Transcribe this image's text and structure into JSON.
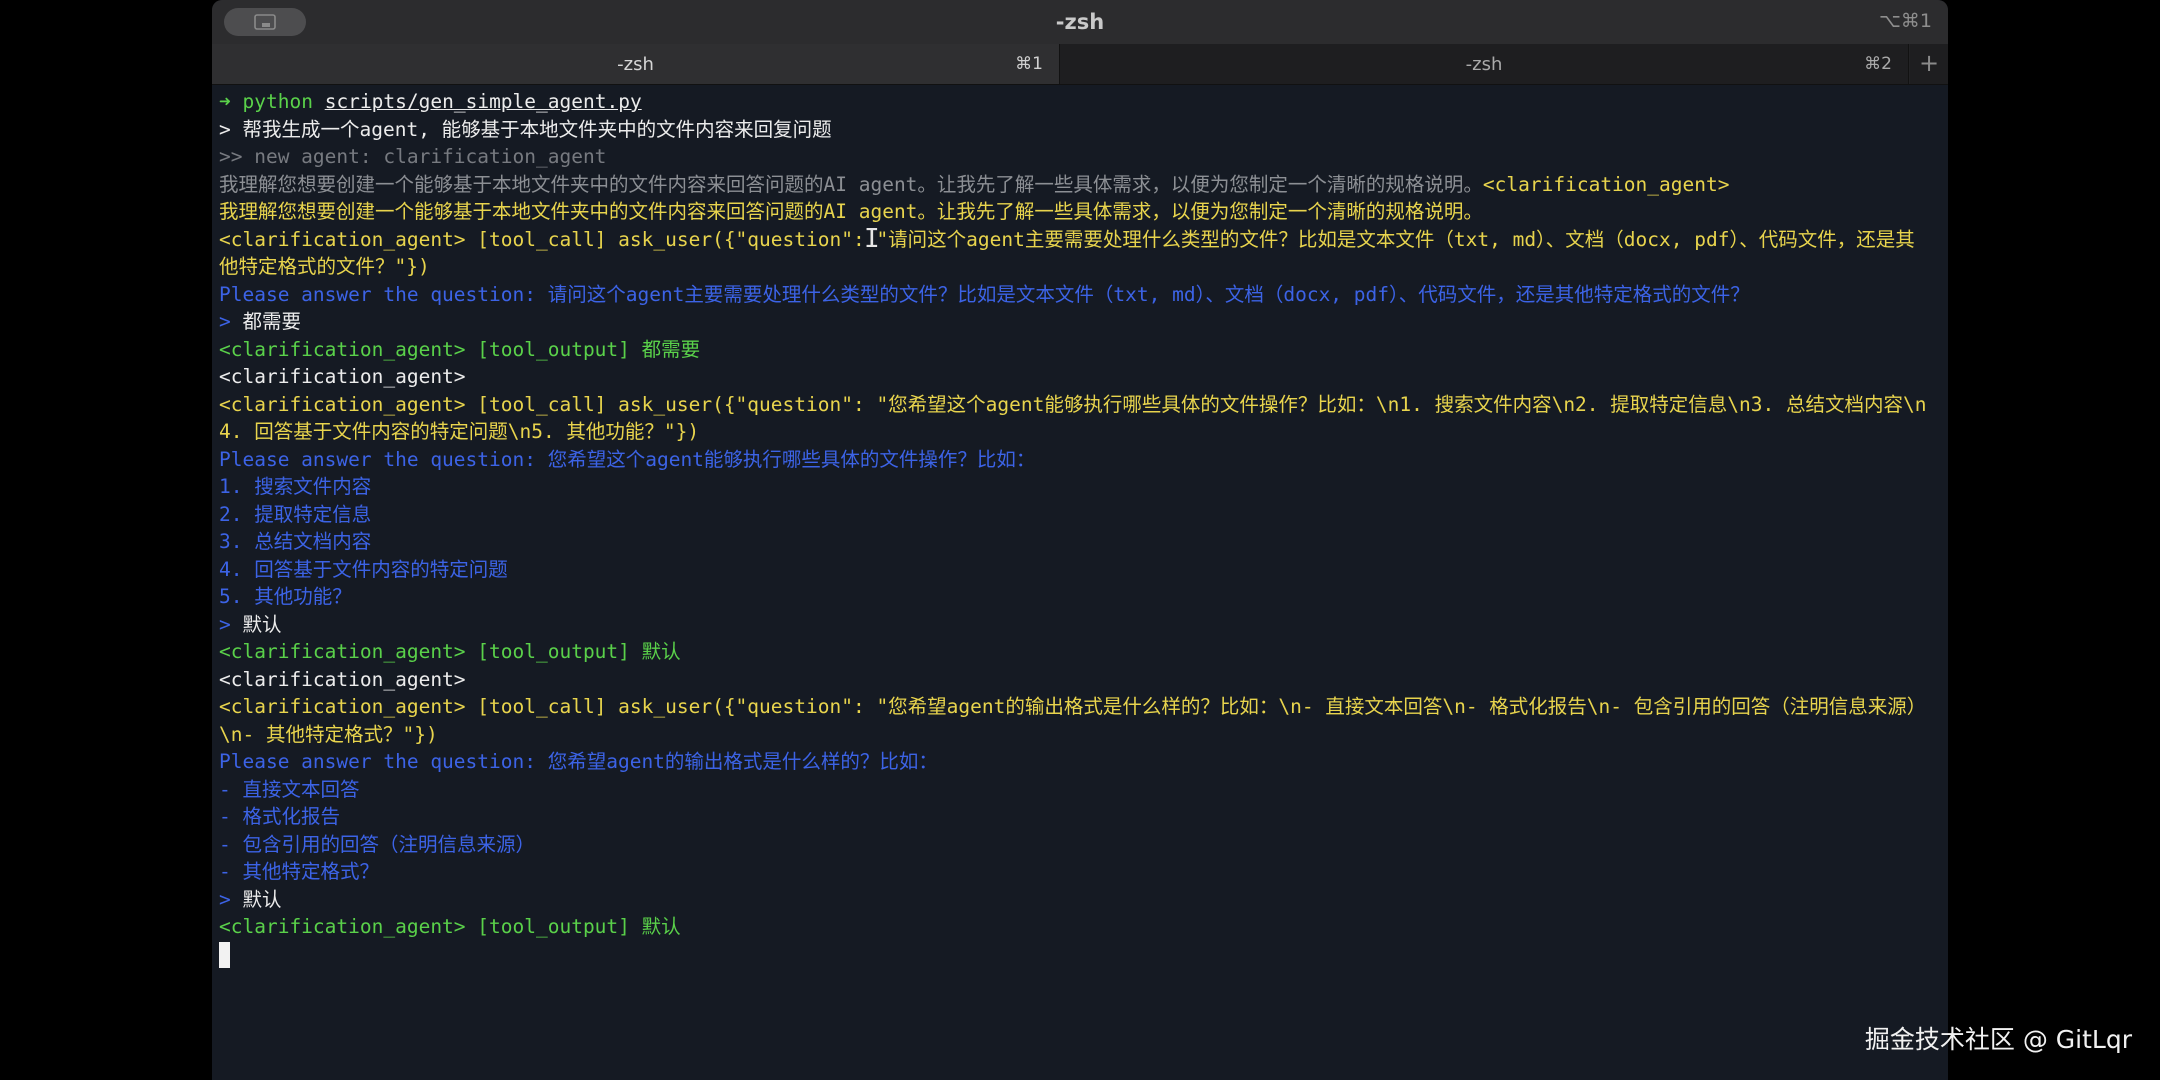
{
  "window": {
    "title": "-zsh",
    "shortcut": "⌥⌘1"
  },
  "tabs": [
    {
      "label": "-zsh",
      "key": "⌘1"
    },
    {
      "label": "-zsh",
      "key": "⌘2"
    }
  ],
  "new_tab_symbol": "+",
  "terminal": {
    "l1_arrow": "➜",
    "l1_cmd": "python",
    "l1_arg": "scripts/gen_simple_agent.py",
    "l2_prompt": ">",
    "l2_text": "帮我生成一个agent, 能够基于本地文件夹中的文件内容来回复问题",
    "l3": ">> new agent: clarification_agent",
    "l4_text": "我理解您想要创建一个能够基于本地文件夹中的文件内容来回答问题的AI agent。让我先了解一些具体需求，以便为您制定一个清晰的规格说明。",
    "l4_tag": "<clarification_agent>",
    "l5": "我理解您想要创建一个能够基于本地文件夹中的文件内容来回答问题的AI agent。让我先了解一些具体需求，以便为您制定一个清晰的规格说明。",
    "l6": "<clarification_agent> [tool_call] ask_user({\"question\": \"请问这个agent主要需要处理什么类型的文件？比如是文本文件（txt, md）、文档（docx, pdf）、代码文件，还是其他特定格式的文件？\"})",
    "l7": "Please answer the question: 请问这个agent主要需要处理什么类型的文件？比如是文本文件（txt, md）、文档（docx, pdf）、代码文件，还是其他特定格式的文件？",
    "l8_prompt": ">",
    "l8_text": "都需要",
    "l9": "<clarification_agent> [tool_output] 都需要",
    "l10": "<clarification_agent>",
    "l11": "<clarification_agent> [tool_call] ask_user({\"question\": \"您希望这个agent能够执行哪些具体的文件操作？比如：\\n1. 搜索文件内容\\n2. 提取特定信息\\n3. 总结文档内容\\n4. 回答基于文件内容的特定问题\\n5. 其他功能？\"})",
    "l12": "Please answer the question: 您希望这个agent能够执行哪些具体的文件操作？比如：",
    "l13": "1. 搜索文件内容",
    "l14": "2. 提取特定信息",
    "l15": "3. 总结文档内容",
    "l16": "4. 回答基于文件内容的特定问题",
    "l17": "5. 其他功能？",
    "l18_prompt": ">",
    "l18_text": "默认",
    "l19": "<clarification_agent> [tool_output] 默认",
    "l20": "<clarification_agent>",
    "l21": "<clarification_agent> [tool_call] ask_user({\"question\": \"您希望agent的输出格式是什么样的？比如：\\n- 直接文本回答\\n- 格式化报告\\n- 包含引用的回答（注明信息来源）\\n- 其他特定格式？\"})",
    "l22": "Please answer the question: 您希望agent的输出格式是什么样的？比如：",
    "l23": "- 直接文本回答",
    "l24": "- 格式化报告",
    "l25": "- 包含引用的回答（注明信息来源）",
    "l26": "- 其他特定格式？",
    "l27_prompt": ">",
    "l27_text": "默认",
    "l28": "<clarification_agent> [tool_output] 默认"
  },
  "colors": {
    "green": "#5ad14a",
    "yellow": "#e8d44d",
    "blue": "#3c63e6",
    "gray": "#777a80",
    "background": "#151a23"
  },
  "watermark": "掘金技术社区 @ GitLqr"
}
